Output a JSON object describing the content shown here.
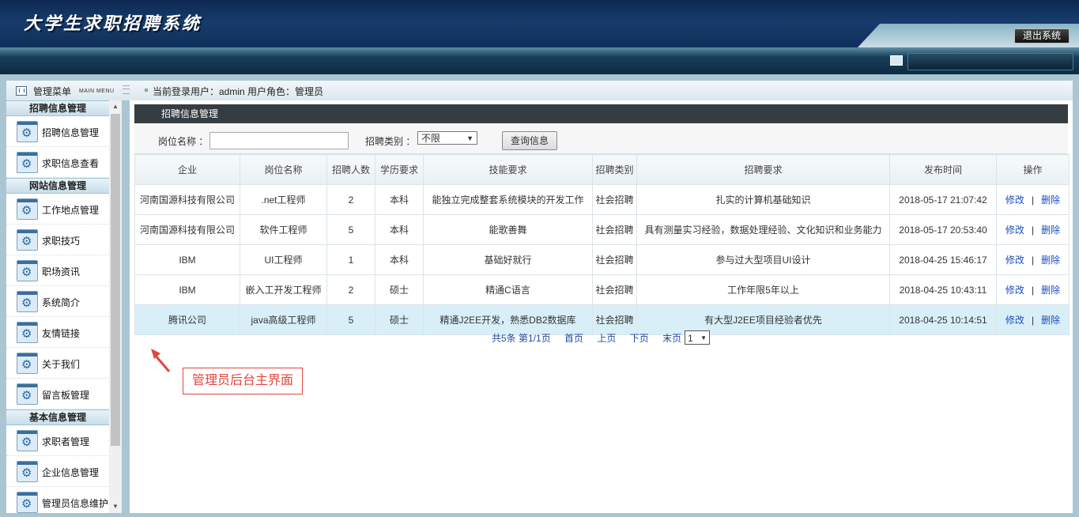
{
  "header": {
    "logo_text": "大学生求职招聘系统",
    "logout_label": "退出系统"
  },
  "menu_bar": {
    "title": "管理菜单",
    "title_en": "MAIN MENU",
    "user_info": "当前登录用户：admin  用户角色：管理员"
  },
  "sidebar": {
    "group1": "招聘信息管理",
    "group2": "网站信息管理",
    "group3": "基本信息管理",
    "items": [
      "招聘信息管理",
      "求职信息查看",
      "工作地点管理",
      "求职技巧",
      "职场资讯",
      "系统简介",
      "友情链接",
      "关于我们",
      "留言板管理",
      "求职者管理",
      "企业信息管理",
      "管理员信息维护"
    ]
  },
  "panel": {
    "title": "招聘信息管理"
  },
  "search": {
    "position_label": "岗位名称 ：",
    "position_value": "",
    "category_label": "招聘类别 ：",
    "category_selected": "不限",
    "query_button": "查询信息"
  },
  "table": {
    "columns": [
      "企业",
      "岗位名称",
      "招聘人数",
      "学历要求",
      "技能要求",
      "招聘类别",
      "招聘要求",
      "发布时间",
      "操作"
    ],
    "rows": [
      [
        "河南国源科技有限公司",
        ".net工程师",
        "2",
        "本科",
        "能独立完成整套系统模块的开发工作",
        "社会招聘",
        "扎实的计算机基础知识",
        "2018-05-17 21:07:42"
      ],
      [
        "河南国源科技有限公司",
        "软件工程师",
        "5",
        "本科",
        "能歌善舞",
        "社会招聘",
        "具有测量实习经验，数据处理经验、文化知识和业务能力",
        "2018-05-17 20:53:40"
      ],
      [
        "IBM",
        "UI工程师",
        "1",
        "本科",
        "基础好就行",
        "社会招聘",
        "参与过大型项目UI设计",
        "2018-04-25 15:46:17"
      ],
      [
        "IBM",
        "嵌入工开发工程师",
        "2",
        "硕士",
        "精通C语言",
        "社会招聘",
        "工作年限5年以上",
        "2018-04-25 10:43:11"
      ],
      [
        "腾讯公司",
        "java高级工程师",
        "5",
        "硕士",
        "精通J2EE开发，熟悉DB2数据库",
        "社会招聘",
        "有大型J2EE项目经验者优先",
        "2018-04-25 10:14:51"
      ]
    ],
    "edit_label": "修改",
    "delete_label": "删除"
  },
  "pager": {
    "summary": "共5条  第1/1页",
    "first": "首页",
    "prev": "上页",
    "next": "下页",
    "last": "末页",
    "page_selected": "1"
  },
  "annotation": {
    "text": "管理员后台主界面",
    "color": "#e0463c"
  }
}
